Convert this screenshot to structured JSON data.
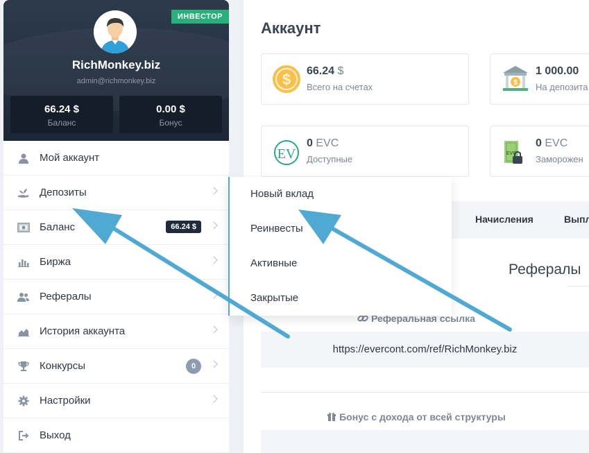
{
  "profile": {
    "role_badge": "ИНВЕСТОР",
    "username": "RichMonkey.biz",
    "email": "admin@richmonkey.biz",
    "balance_value": "66.24 $",
    "balance_label": "Баланс",
    "bonus_value": "0.00 $",
    "bonus_label": "Бонус"
  },
  "menu": {
    "items": [
      {
        "label": "Мой аккаунт",
        "icon": "user-icon"
      },
      {
        "label": "Депозиты",
        "icon": "plant-hand-icon"
      },
      {
        "label": "Баланс",
        "icon": "money-icon",
        "pill": "66.24 $"
      },
      {
        "label": "Биржа",
        "icon": "bar-chart-icon"
      },
      {
        "label": "Рефералы",
        "icon": "users-icon"
      },
      {
        "label": "История аккаунта",
        "icon": "area-chart-icon"
      },
      {
        "label": "Конкурсы",
        "icon": "trophy-icon",
        "count": "0"
      },
      {
        "label": "Настройки",
        "icon": "gear-icon"
      },
      {
        "label": "Выход",
        "icon": "sign-out-icon"
      }
    ]
  },
  "dropdown": {
    "items": [
      "Новый вклад",
      "Реинвесты",
      "Активные",
      "Закрытые"
    ]
  },
  "main": {
    "title": "Аккаунт",
    "cards": [
      {
        "value": "66.24",
        "unit": "$",
        "label": "Всего на счетах",
        "icon": "dollar-coin-icon"
      },
      {
        "value": "1 000.00",
        "unit": "",
        "label": "На депозита",
        "icon": "bank-icon"
      },
      {
        "value": "0",
        "unit": "EVC",
        "label": "Доступные",
        "icon": "evc-coin-icon"
      },
      {
        "value": "0",
        "unit": "EVC",
        "label": "Заморожен",
        "icon": "locked-money-icon"
      }
    ],
    "tabs": [
      "Начисления",
      "Выпл"
    ],
    "referrals_title": "Рефералы",
    "ref_link_caption": "Реферальная ссылка",
    "ref_link": "https://evercont.com/ref/RichMonkey.biz",
    "bonus_caption": "Бонус с дохода от всей структуры"
  },
  "colors": {
    "accent_green": "#27b07a",
    "arrow_blue": "#4fa9d2",
    "sidebar_dark": "#1c2735"
  }
}
